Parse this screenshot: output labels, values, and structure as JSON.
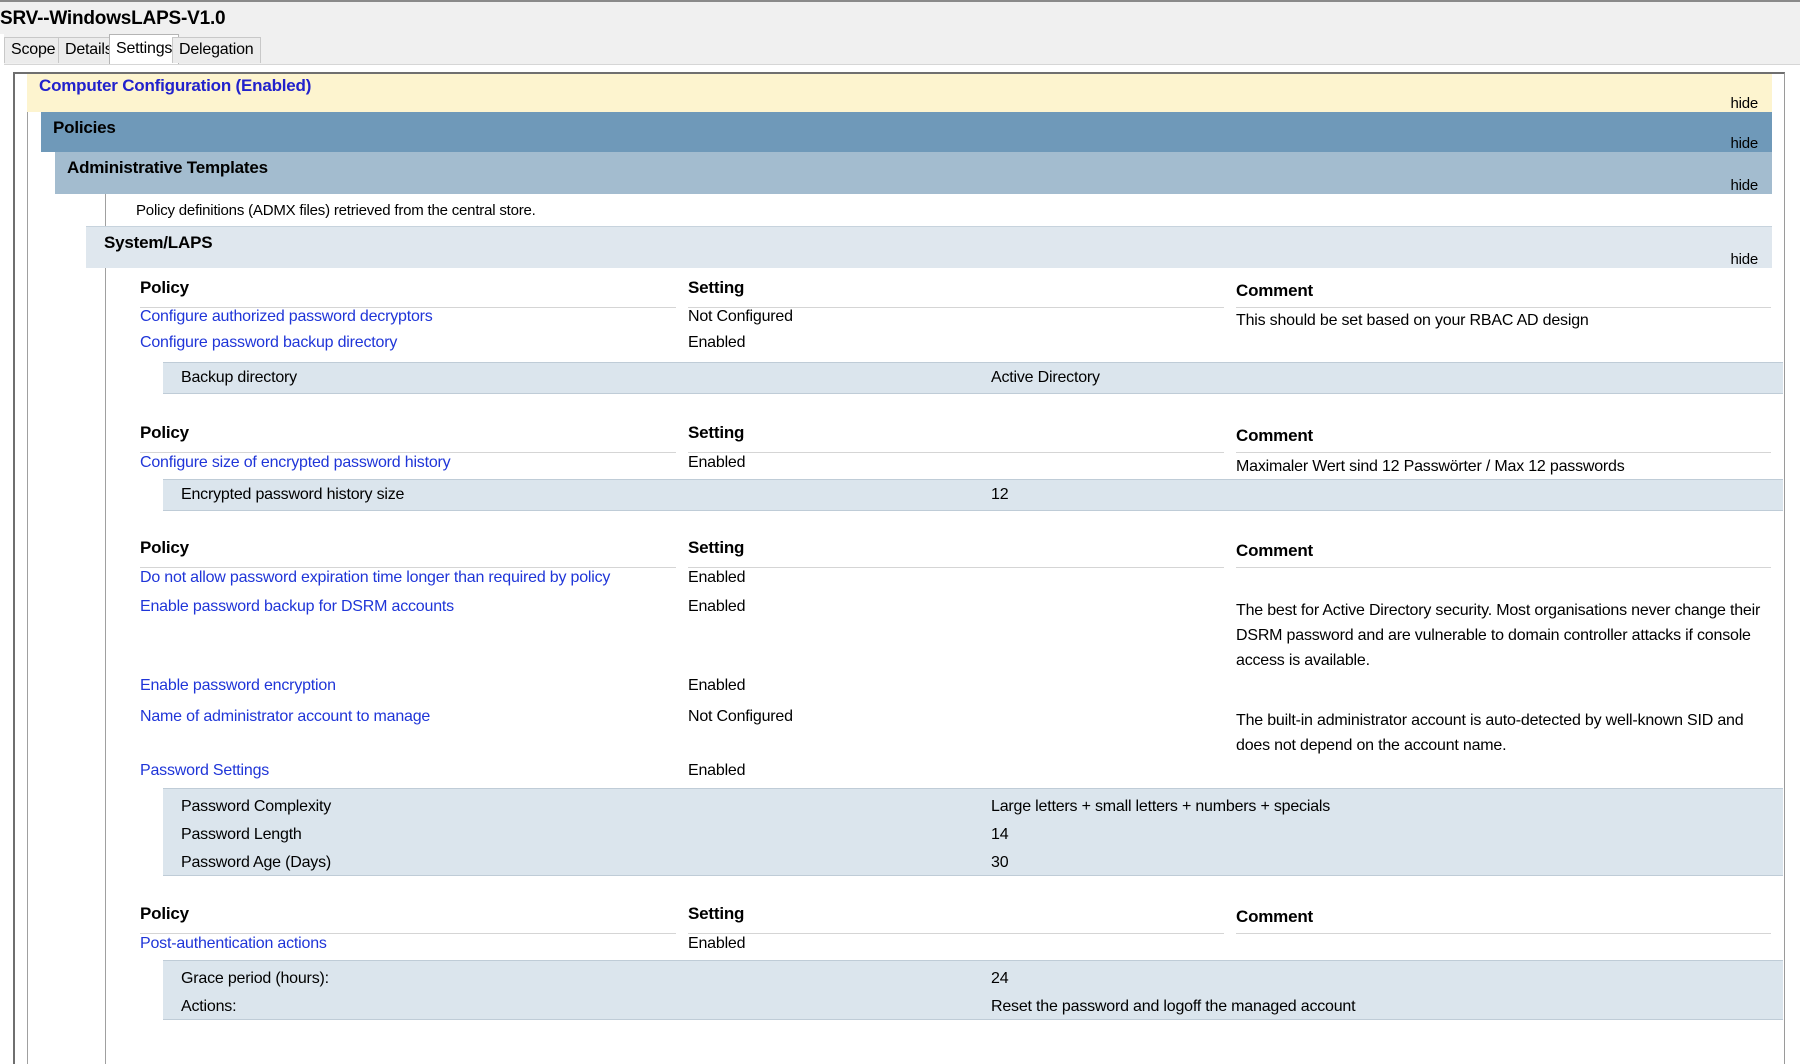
{
  "window": {
    "title": "SRV--WindowsLAPS-V1.0"
  },
  "tabs": [
    {
      "label": "Scope",
      "active": false
    },
    {
      "label": "Details",
      "active": false
    },
    {
      "label": "Settings",
      "active": true
    },
    {
      "label": "Delegation",
      "active": false
    }
  ],
  "sections": {
    "computer_configuration": {
      "title": "Computer Configuration (Enabled)",
      "hide": "hide"
    },
    "policies": {
      "title": "Policies",
      "hide": "hide"
    },
    "admin_templates": {
      "title": "Administrative Templates",
      "hide": "hide",
      "note": "Policy definitions (ADMX files) retrieved from the central store."
    },
    "system_laps": {
      "title": "System/LAPS",
      "hide": "hide"
    }
  },
  "columns": {
    "policy": "Policy",
    "setting": "Setting",
    "comment": "Comment"
  },
  "groups": [
    {
      "rows": [
        {
          "policy": "Configure authorized password decryptors",
          "setting": "Not Configured",
          "comment": "This should be set based on your RBAC AD design"
        },
        {
          "policy": "Configure password backup directory",
          "setting": "Enabled",
          "comment": ""
        }
      ],
      "details": [
        {
          "key": "Backup directory",
          "value": "Active Directory"
        }
      ]
    },
    {
      "rows": [
        {
          "policy": "Configure size of encrypted password history",
          "setting": "Enabled",
          "comment": "Maximaler Wert sind 12 Passwörter / Max 12 passwords"
        }
      ],
      "details": [
        {
          "key": "Encrypted password history size",
          "value": "12"
        }
      ]
    },
    {
      "rows": [
        {
          "policy": "Do not allow password expiration time longer than required by policy",
          "setting": "Enabled",
          "comment": ""
        },
        {
          "policy": "Enable password backup for DSRM accounts",
          "setting": "Enabled",
          "comment": "The best for Active Directory security. Most organisations never change their DSRM password and are vulnerable to domain controller attacks if console access is available."
        },
        {
          "policy": "Enable password encryption",
          "setting": "Enabled",
          "comment": ""
        },
        {
          "policy": "Name of administrator account to manage",
          "setting": "Not Configured",
          "comment": "The built-in administrator account is auto-detected by well-known SID and does not depend on the account name."
        },
        {
          "policy": "Password Settings",
          "setting": "Enabled",
          "comment": ""
        }
      ],
      "details": [
        {
          "key": "Password Complexity",
          "value": "Large letters + small letters + numbers + specials"
        },
        {
          "key": "Password Length",
          "value": "14"
        },
        {
          "key": "Password Age (Days)",
          "value": "30"
        }
      ]
    },
    {
      "rows": [
        {
          "policy": "Post-authentication actions",
          "setting": "Enabled",
          "comment": ""
        }
      ],
      "details": [
        {
          "key": "Grace period (hours):",
          "value": "24"
        },
        {
          "key": "Actions:",
          "value": "Reset the password and logoff the managed account"
        }
      ]
    }
  ]
}
